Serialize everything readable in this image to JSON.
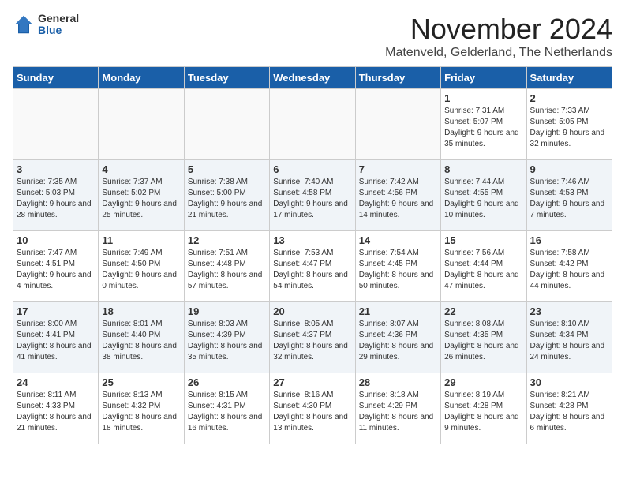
{
  "logo": {
    "general": "General",
    "blue": "Blue"
  },
  "header": {
    "month": "November 2024",
    "location": "Matenveld, Gelderland, The Netherlands"
  },
  "weekdays": [
    "Sunday",
    "Monday",
    "Tuesday",
    "Wednesday",
    "Thursday",
    "Friday",
    "Saturday"
  ],
  "weeks": [
    [
      {
        "day": "",
        "info": ""
      },
      {
        "day": "",
        "info": ""
      },
      {
        "day": "",
        "info": ""
      },
      {
        "day": "",
        "info": ""
      },
      {
        "day": "",
        "info": ""
      },
      {
        "day": "1",
        "info": "Sunrise: 7:31 AM\nSunset: 5:07 PM\nDaylight: 9 hours and 35 minutes."
      },
      {
        "day": "2",
        "info": "Sunrise: 7:33 AM\nSunset: 5:05 PM\nDaylight: 9 hours and 32 minutes."
      }
    ],
    [
      {
        "day": "3",
        "info": "Sunrise: 7:35 AM\nSunset: 5:03 PM\nDaylight: 9 hours and 28 minutes."
      },
      {
        "day": "4",
        "info": "Sunrise: 7:37 AM\nSunset: 5:02 PM\nDaylight: 9 hours and 25 minutes."
      },
      {
        "day": "5",
        "info": "Sunrise: 7:38 AM\nSunset: 5:00 PM\nDaylight: 9 hours and 21 minutes."
      },
      {
        "day": "6",
        "info": "Sunrise: 7:40 AM\nSunset: 4:58 PM\nDaylight: 9 hours and 17 minutes."
      },
      {
        "day": "7",
        "info": "Sunrise: 7:42 AM\nSunset: 4:56 PM\nDaylight: 9 hours and 14 minutes."
      },
      {
        "day": "8",
        "info": "Sunrise: 7:44 AM\nSunset: 4:55 PM\nDaylight: 9 hours and 10 minutes."
      },
      {
        "day": "9",
        "info": "Sunrise: 7:46 AM\nSunset: 4:53 PM\nDaylight: 9 hours and 7 minutes."
      }
    ],
    [
      {
        "day": "10",
        "info": "Sunrise: 7:47 AM\nSunset: 4:51 PM\nDaylight: 9 hours and 4 minutes."
      },
      {
        "day": "11",
        "info": "Sunrise: 7:49 AM\nSunset: 4:50 PM\nDaylight: 9 hours and 0 minutes."
      },
      {
        "day": "12",
        "info": "Sunrise: 7:51 AM\nSunset: 4:48 PM\nDaylight: 8 hours and 57 minutes."
      },
      {
        "day": "13",
        "info": "Sunrise: 7:53 AM\nSunset: 4:47 PM\nDaylight: 8 hours and 54 minutes."
      },
      {
        "day": "14",
        "info": "Sunrise: 7:54 AM\nSunset: 4:45 PM\nDaylight: 8 hours and 50 minutes."
      },
      {
        "day": "15",
        "info": "Sunrise: 7:56 AM\nSunset: 4:44 PM\nDaylight: 8 hours and 47 minutes."
      },
      {
        "day": "16",
        "info": "Sunrise: 7:58 AM\nSunset: 4:42 PM\nDaylight: 8 hours and 44 minutes."
      }
    ],
    [
      {
        "day": "17",
        "info": "Sunrise: 8:00 AM\nSunset: 4:41 PM\nDaylight: 8 hours and 41 minutes."
      },
      {
        "day": "18",
        "info": "Sunrise: 8:01 AM\nSunset: 4:40 PM\nDaylight: 8 hours and 38 minutes."
      },
      {
        "day": "19",
        "info": "Sunrise: 8:03 AM\nSunset: 4:39 PM\nDaylight: 8 hours and 35 minutes."
      },
      {
        "day": "20",
        "info": "Sunrise: 8:05 AM\nSunset: 4:37 PM\nDaylight: 8 hours and 32 minutes."
      },
      {
        "day": "21",
        "info": "Sunrise: 8:07 AM\nSunset: 4:36 PM\nDaylight: 8 hours and 29 minutes."
      },
      {
        "day": "22",
        "info": "Sunrise: 8:08 AM\nSunset: 4:35 PM\nDaylight: 8 hours and 26 minutes."
      },
      {
        "day": "23",
        "info": "Sunrise: 8:10 AM\nSunset: 4:34 PM\nDaylight: 8 hours and 24 minutes."
      }
    ],
    [
      {
        "day": "24",
        "info": "Sunrise: 8:11 AM\nSunset: 4:33 PM\nDaylight: 8 hours and 21 minutes."
      },
      {
        "day": "25",
        "info": "Sunrise: 8:13 AM\nSunset: 4:32 PM\nDaylight: 8 hours and 18 minutes."
      },
      {
        "day": "26",
        "info": "Sunrise: 8:15 AM\nSunset: 4:31 PM\nDaylight: 8 hours and 16 minutes."
      },
      {
        "day": "27",
        "info": "Sunrise: 8:16 AM\nSunset: 4:30 PM\nDaylight: 8 hours and 13 minutes."
      },
      {
        "day": "28",
        "info": "Sunrise: 8:18 AM\nSunset: 4:29 PM\nDaylight: 8 hours and 11 minutes."
      },
      {
        "day": "29",
        "info": "Sunrise: 8:19 AM\nSunset: 4:28 PM\nDaylight: 8 hours and 9 minutes."
      },
      {
        "day": "30",
        "info": "Sunrise: 8:21 AM\nSunset: 4:28 PM\nDaylight: 8 hours and 6 minutes."
      }
    ]
  ]
}
